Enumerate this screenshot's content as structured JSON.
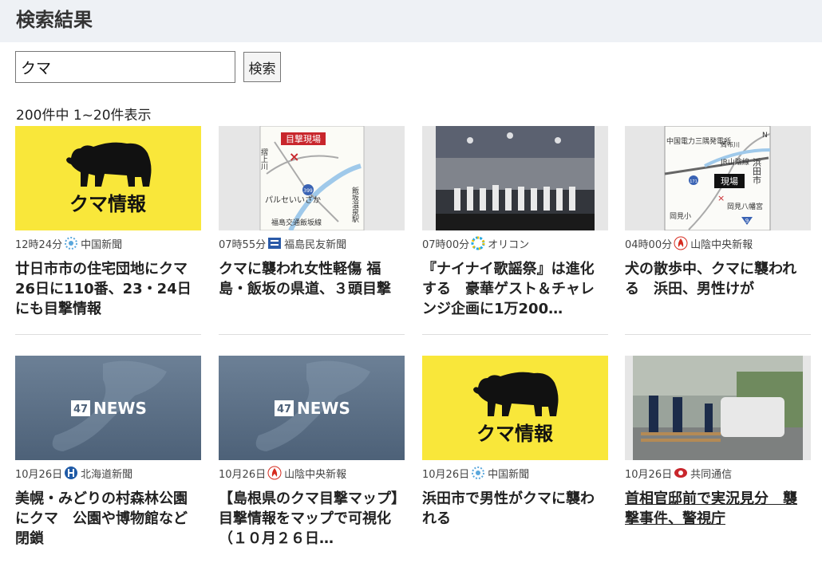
{
  "header": {
    "title": "検索結果"
  },
  "search": {
    "value": "クマ",
    "button_label": "検索"
  },
  "results_summary": "200件中 1~20件表示",
  "bear_thumb_label": "クマ情報",
  "news_thumb_label": "47NEWS",
  "map_labels": {
    "fukushima": {
      "tag": "目撃現場",
      "bridge": "パルセいいざか",
      "station": "福島交通飯坂線",
      "town": "飯坂温泉駅",
      "river": "摺上川",
      "route": "399"
    },
    "hamada": {
      "company": "中国電力三隅発電所",
      "rail": "JR山陰線",
      "city": "浜田市",
      "spot": "現場",
      "shrine": "岡見八幡宮",
      "school": "岡見小",
      "river": "周布川",
      "route9": "9",
      "route171": "171",
      "north": "N"
    }
  },
  "articles": [
    {
      "time": "12時24分",
      "source": "中国新聞",
      "title": "廿日市市の住宅団地にクマ　26日に110番、23・24日にも目撃情報",
      "thumb": "bear"
    },
    {
      "time": "07時55分",
      "source": "福島民友新聞",
      "title": "クマに襲われ女性軽傷 福島・飯坂の県道、３頭目撃",
      "thumb": "map-fukushima"
    },
    {
      "time": "07時00分",
      "source": "オリコン",
      "title": "『ナイナイ歌謡祭』は進化する　豪華ゲスト＆チャレンジ企画に1万200…",
      "thumb": "concert"
    },
    {
      "time": "04時00分",
      "source": "山陰中央新報",
      "title": "犬の散歩中、クマに襲われる　浜田、男性けが",
      "thumb": "map-hamada"
    },
    {
      "time": "10月26日",
      "source": "北海道新聞",
      "title": "美幌・みどりの村森林公園にクマ　公園や博物館など閉鎖",
      "thumb": "news"
    },
    {
      "time": "10月26日",
      "source": "山陰中央新報",
      "title": "【島根県のクマ目撃マップ】目撃情報をマップで可視化（１０月２６日…",
      "thumb": "news"
    },
    {
      "time": "10月26日",
      "source": "中国新聞",
      "title": "浜田市で男性がクマに襲われる",
      "thumb": "bear"
    },
    {
      "time": "10月26日",
      "source": "共同通信",
      "title": "首相官邸前で実況見分　襲撃事件、警視庁",
      "thumb": "police"
    }
  ]
}
